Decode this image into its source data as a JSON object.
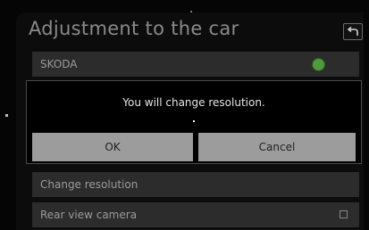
{
  "header": {
    "title": "Adjustment to the car",
    "back_icon": "back-arrow-icon"
  },
  "list": {
    "brand_item": {
      "label": "SKODA",
      "icon": "skoda-logo-icon",
      "icon_color": "#4f9a3a"
    },
    "change_resolution_item": {
      "label": "Change resolution"
    },
    "rear_camera_item": {
      "label": "Rear view camera",
      "checked": false
    }
  },
  "dialog": {
    "message": "You will change resolution.",
    "ok_label": "OK",
    "cancel_label": "Cancel"
  }
}
